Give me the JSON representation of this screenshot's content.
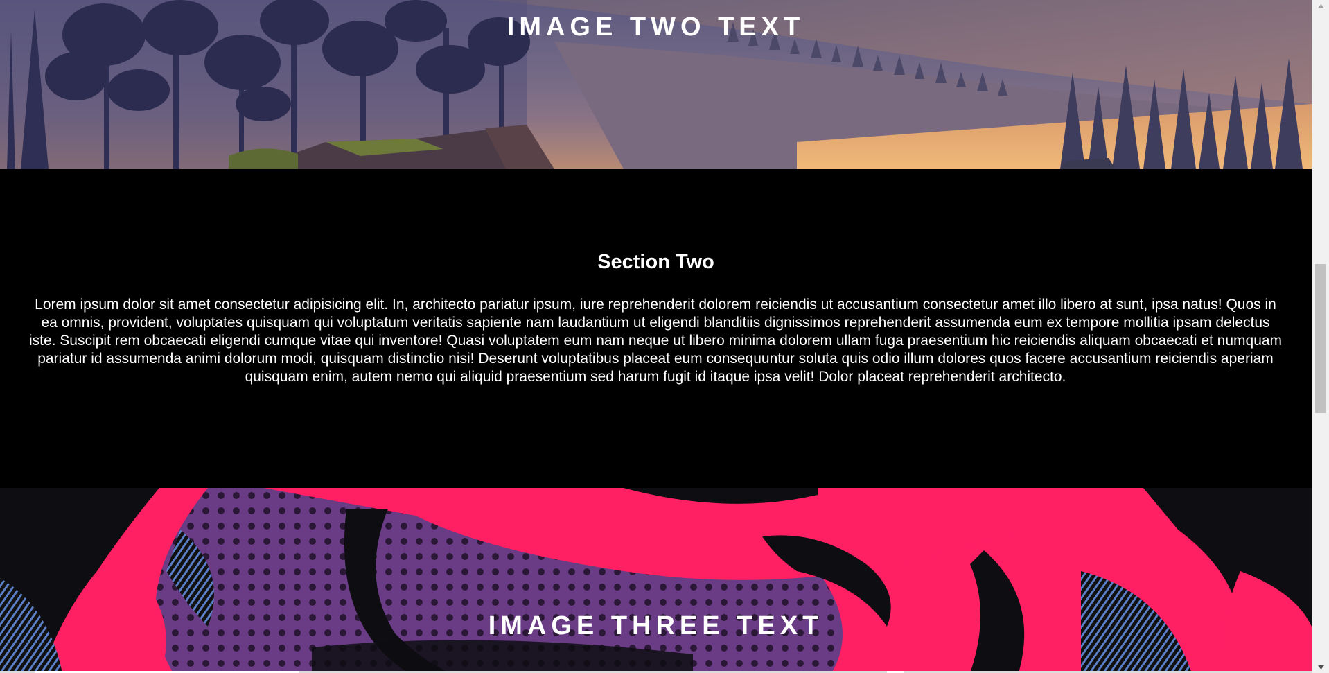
{
  "section_image_two": {
    "title": "IMAGE TWO TEXT"
  },
  "section_two": {
    "heading": "Section Two",
    "body": "Lorem ipsum dolor sit amet consectetur adipisicing elit. In, architecto pariatur ipsum, iure reprehenderit dolorem reiciendis ut accusantium consectetur amet illo libero at sunt, ipsa natus! Quos in ea omnis, provident, voluptates quisquam qui voluptatum veritatis sapiente nam laudantium ut eligendi blanditiis dignissimos reprehenderit assumenda eum ex tempore mollitia ipsam delectus iste. Suscipit rem obcaecati eligendi cumque vitae qui inventore! Quasi voluptatem eum nam neque ut libero minima dolorem ullam fuga praesentium hic reiciendis aliquam obcaecati et numquam pariatur id assumenda animi dolorum modi, quisquam distinctio nisi! Deserunt voluptatibus placeat eum consequuntur soluta quis odio illum dolores quos facere accusantium reiciendis aperiam quisquam enim, autem nemo qui aliquid praesentium sed harum fugit id itaque ipsa velit! Dolor placeat reprehenderit architecto."
  },
  "section_image_three": {
    "title": "IMAGE THREE TEXT"
  },
  "theme": {
    "section_background": "#000000",
    "text_color": "#ffffff",
    "comic_pink": "#ff1f63",
    "comic_purple": "#5a2a7a",
    "landscape_glow": "#e8a066"
  },
  "scrollbar": {
    "up_icon": "triangle-up-icon",
    "down_icon": "triangle-down-icon"
  }
}
